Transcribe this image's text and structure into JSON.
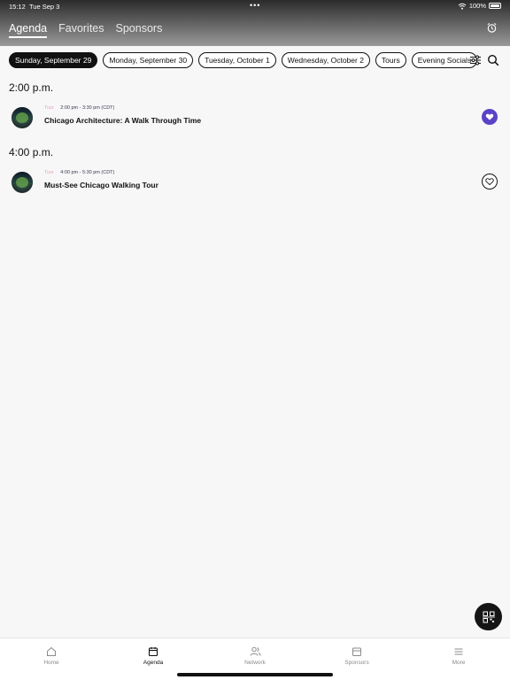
{
  "status_bar": {
    "time": "15:12",
    "date": "Tue Sep 3",
    "dots": "•••",
    "battery": "100%"
  },
  "top_tabs": [
    {
      "label": "Agenda",
      "active": true
    },
    {
      "label": "Favorites",
      "active": false
    },
    {
      "label": "Sponsors",
      "active": false
    }
  ],
  "filters": [
    {
      "label": "Sunday, September 29",
      "active": true
    },
    {
      "label": "Monday, September 30",
      "active": false
    },
    {
      "label": "Tuesday, October 1",
      "active": false
    },
    {
      "label": "Wednesday, October 2",
      "active": false
    },
    {
      "label": "Tours",
      "active": false
    },
    {
      "label": "Evening Socials",
      "active": false
    }
  ],
  "sections": [
    {
      "time": "2:00 p.m.",
      "session": {
        "type": "Tour",
        "time_range": "2:00 pm - 3:30 pm (CDT)",
        "title": "Chicago Architecture: A Walk Through Time",
        "favorited": true
      }
    },
    {
      "time": "4:00 p.m.",
      "session": {
        "type": "Tour",
        "time_range": "4:00 pm - 5:30 pm (CDT)",
        "title": "Must-See Chicago Walking Tour",
        "favorited": false
      }
    }
  ],
  "bottom_nav": [
    {
      "label": "Home",
      "icon": "home-icon",
      "active": false
    },
    {
      "label": "Agenda",
      "icon": "calendar-icon",
      "active": true
    },
    {
      "label": "Network",
      "icon": "people-icon",
      "active": false
    },
    {
      "label": "Sponsors",
      "icon": "storefront-icon",
      "active": false
    },
    {
      "label": "More",
      "icon": "menu-icon",
      "active": false
    }
  ],
  "colors": {
    "accent": "#5b43c8",
    "chip_active_bg": "#111111",
    "tour_label": "#e4a7c0"
  }
}
